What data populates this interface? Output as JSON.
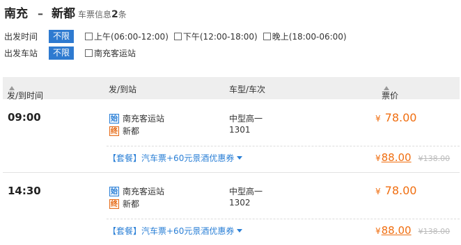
{
  "route": {
    "from": "南充",
    "separator": "–",
    "to": "新都",
    "info_label": "车票信息",
    "count": "2",
    "count_unit": "条"
  },
  "filters": {
    "departure_time": {
      "label": "出发时间",
      "tag": "不限",
      "options": [
        "上午(06:00-12:00)",
        "下午(12:00-18:00)",
        "晚上(18:00-06:00)"
      ]
    },
    "departure_station": {
      "label": "出发车站",
      "tag": "不限",
      "options": [
        "南充客运站"
      ]
    }
  },
  "table": {
    "headers": {
      "time": "发/到时间",
      "station": "发/到站",
      "vehicle": "车型/车次",
      "price": "票价"
    }
  },
  "trips": [
    {
      "time": "09:00",
      "start_icon": "始",
      "from_station": "南充客运站",
      "end_icon": "终",
      "to_station": "新都",
      "vehicle_type": "中型高一",
      "trip_no": "1301",
      "currency": "¥",
      "price": "78.00",
      "package_label": "【套餐】汽车票+60元景酒优惠券",
      "package_price": "88.00",
      "package_original": "¥138.00"
    },
    {
      "time": "14:30",
      "start_icon": "始",
      "from_station": "南充客运站",
      "end_icon": "终",
      "to_station": "新都",
      "vehicle_type": "中型高一",
      "trip_no": "1302",
      "currency": "¥",
      "price": "78.00",
      "package_label": "【套餐】汽车票+60元景酒优惠券",
      "package_price": "88.00",
      "package_original": "¥138.00"
    }
  ],
  "colors": {
    "accent_blue": "#2e7ad0",
    "price_orange": "#f06e10",
    "header_bg": "#eeeeee"
  }
}
